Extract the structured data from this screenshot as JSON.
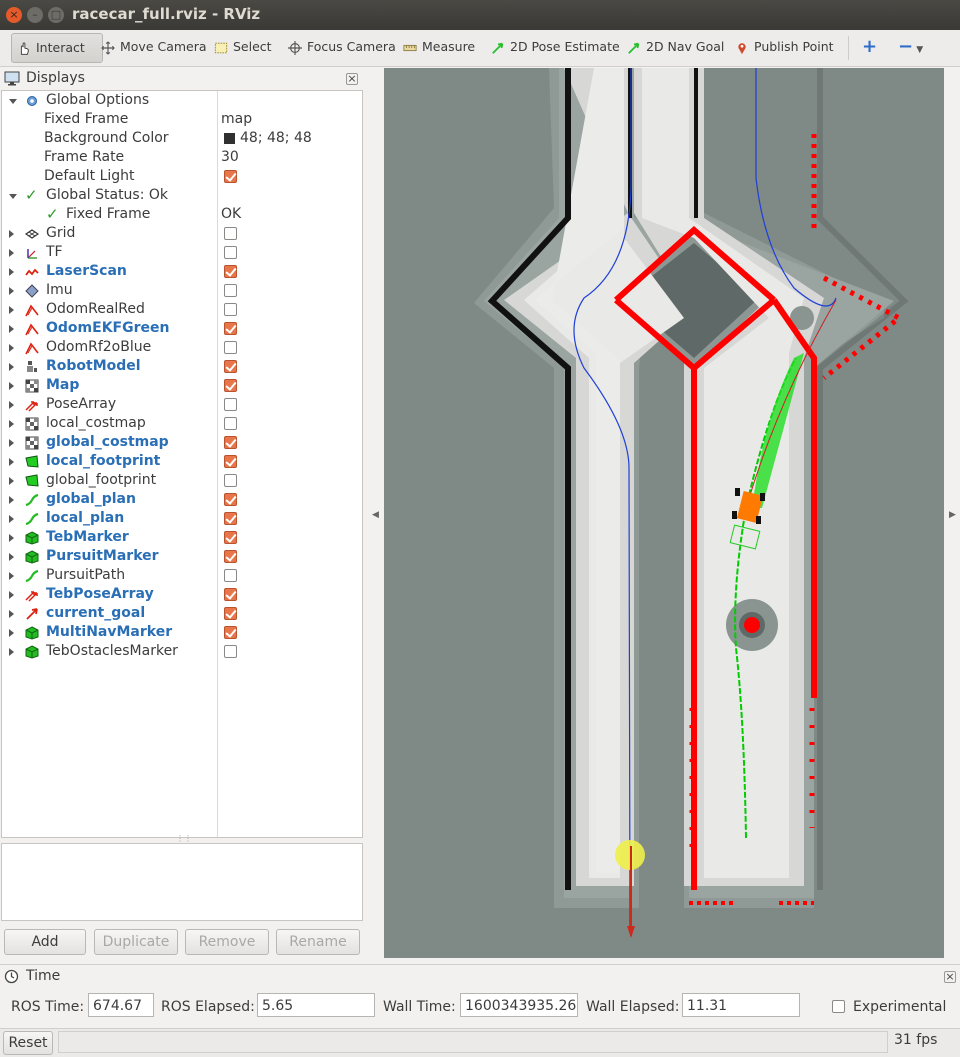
{
  "window": {
    "title": "racecar_full.rviz - RViz",
    "close": "×",
    "minimize": "–",
    "maximize": "□"
  },
  "toolbar": {
    "interact": "Interact",
    "move_camera": "Move Camera",
    "select": "Select",
    "focus_camera": "Focus Camera",
    "measure": "Measure",
    "pose_estimate": "2D Pose Estimate",
    "nav_goal": "2D Nav Goal",
    "publish_point": "Publish Point"
  },
  "displays": {
    "header": "Displays",
    "global_options": {
      "label": "Global Options",
      "fixed_frame_label": "Fixed Frame",
      "fixed_frame_value": "map",
      "bg_label": "Background Color",
      "bg_value": "48; 48; 48",
      "frame_rate_label": "Frame Rate",
      "frame_rate_value": "30",
      "default_light_label": "Default Light"
    },
    "global_status": {
      "label": "Global Status: Ok",
      "fixed_frame_label": "Fixed Frame",
      "fixed_frame_value": "OK"
    },
    "items": [
      {
        "label": "Grid",
        "checked": false,
        "active": false,
        "icon": "grid-icon"
      },
      {
        "label": "TF",
        "checked": false,
        "active": false,
        "icon": "tf-icon"
      },
      {
        "label": "LaserScan",
        "checked": true,
        "active": true,
        "icon": "laserscan-icon"
      },
      {
        "label": "Imu",
        "checked": false,
        "active": false,
        "icon": "imu-icon"
      },
      {
        "label": "OdomRealRed",
        "checked": false,
        "active": false,
        "icon": "odometry-icon"
      },
      {
        "label": "OdomEKFGreen",
        "checked": true,
        "active": true,
        "icon": "odometry-icon"
      },
      {
        "label": "OdomRf2oBlue",
        "checked": false,
        "active": false,
        "icon": "odometry-icon"
      },
      {
        "label": "RobotModel",
        "checked": true,
        "active": true,
        "icon": "robot-model-icon"
      },
      {
        "label": "Map",
        "checked": true,
        "active": true,
        "icon": "map-icon"
      },
      {
        "label": "PoseArray",
        "checked": false,
        "active": false,
        "icon": "pose-array-icon"
      },
      {
        "label": "local_costmap",
        "checked": false,
        "active": false,
        "icon": "map-icon"
      },
      {
        "label": "global_costmap",
        "checked": true,
        "active": true,
        "icon": "map-icon"
      },
      {
        "label": "local_footprint",
        "checked": true,
        "active": true,
        "icon": "polygon-icon"
      },
      {
        "label": "global_footprint",
        "checked": false,
        "active": false,
        "icon": "polygon-icon"
      },
      {
        "label": "global_plan",
        "checked": true,
        "active": true,
        "icon": "path-icon"
      },
      {
        "label": "local_plan",
        "checked": true,
        "active": true,
        "icon": "path-icon"
      },
      {
        "label": "TebMarker",
        "checked": true,
        "active": true,
        "icon": "marker-cube-icon"
      },
      {
        "label": "PursuitMarker",
        "checked": true,
        "active": true,
        "icon": "marker-cube-icon"
      },
      {
        "label": "PursuitPath",
        "checked": false,
        "active": false,
        "icon": "path-icon"
      },
      {
        "label": "TebPoseArray",
        "checked": true,
        "active": true,
        "icon": "pose-array-icon"
      },
      {
        "label": "current_goal",
        "checked": true,
        "active": true,
        "icon": "pose-icon"
      },
      {
        "label": "MultiNavMarker",
        "checked": true,
        "active": true,
        "icon": "marker-cube-icon"
      },
      {
        "label": "TebOstaclesMarker",
        "checked": false,
        "active": false,
        "icon": "marker-cube-icon"
      }
    ],
    "buttons": {
      "add": "Add",
      "duplicate": "Duplicate",
      "remove": "Remove",
      "rename": "Rename"
    }
  },
  "time": {
    "header": "Time",
    "ros_time_label": "ROS Time:",
    "ros_time": "674.67",
    "ros_elapsed_label": "ROS Elapsed:",
    "ros_elapsed": "5.65",
    "wall_time_label": "Wall Time:",
    "wall_time": "1600343935.26",
    "wall_elapsed_label": "Wall Elapsed:",
    "wall_elapsed": "11.31",
    "experimental_label": "Experimental"
  },
  "status": {
    "reset": "Reset",
    "fps": "31 fps"
  },
  "colors": {
    "accent_checkbox": "#e8764a",
    "active_label": "#2a6fb6",
    "scan_red": "#ff0000",
    "plan_green": "#00cc00",
    "global_plan_blue": "#1f3fd6",
    "bg_swatch": "#303030"
  }
}
